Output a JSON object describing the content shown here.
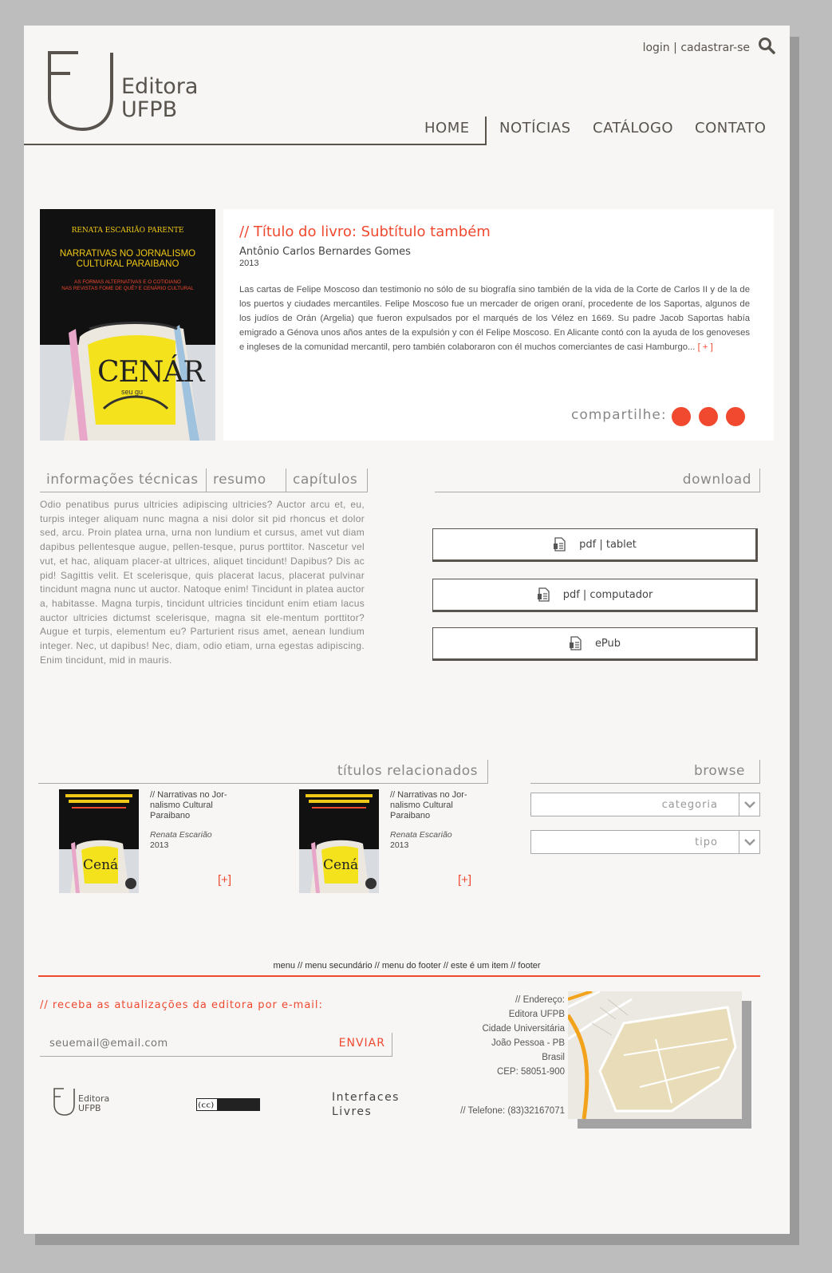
{
  "brand": {
    "logo_line1": "Editora",
    "logo_line2": "UFPB"
  },
  "top_links": {
    "login": "login",
    "separator": " | ",
    "register": "cadastrar-se"
  },
  "nav": {
    "home": "HOME",
    "news": "NOTÍCIAS",
    "catalog": "CATÁLOGO",
    "contact": "CONTATO"
  },
  "feature": {
    "cover_author": "RENATA ESCARIÃO PARENTE",
    "cover_title1": "NARRATIVAS NO JORNALISMO",
    "cover_title2": "CULTURAL PARAIBANO",
    "cover_subtitle1": "AS FORMAS ALTERNATIVAS E O COTIDIANO",
    "cover_subtitle2": "NAS REVISTAS FOME DE QUÊ? E CENÁRIO CULTURAL",
    "cover_word": "CENÁR",
    "cover_small": "seu gu",
    "title": "// Título do livro: Subtítulo também",
    "author": "Antônio Carlos Bernardes Gomes",
    "year": "2013",
    "description": "Las cartas de Felipe Moscoso dan testimonio no sólo de su biografía sino también de la vida de la Corte de Carlos II y de la de los puertos y ciudades mercantiles. Felipe Moscoso fue un mercader de origen oraní, procedente de los Saportas, algunos de los judíos de Orán (Argelia) que fueron expulsados por el marqués de los Vélez en 1669. Su padre Jacob Saportas había emigrado a Génova unos años antes de la expulsión y con él Felipe Moscoso. En Alicante contó con la ayuda de los genoveses e ingleses de la comunidad mercantil, pero también colaboraron con él muchos comerciantes de casi Hamburgo...",
    "more": "[ + ]",
    "share_label": "compartilhe:"
  },
  "tabs": [
    "informações técnicas",
    "resumo",
    "capítulos"
  ],
  "tab_content": "Odio penatibus purus ultricies adipiscing ultricies? Auctor arcu et, eu, turpis integer aliquam nunc magna a nisi dolor sit pid rhoncus et dolor sed, arcu. Proin platea urna, urna non lundium et cursus, amet vut diam dapibus pellentesque augue, pellen-tesque, purus porttitor. Nascetur vel vut, et hac, aliquam placer-at ultrices, aliquet tincidunt! Dapibus? Dis ac pid! Sagittis velit. Et scelerisque, quis placerat lacus, placerat pulvinar tincidunt magna nunc ut auctor. Natoque enim! Tincidunt in platea auctor a, habitasse. Magna turpis, tincidunt ultricies tincidunt enim etiam lacus auctor ultricies dictumst scelerisque, magna sit ele-mentum porttitor? Augue et turpis, elementum eu? Parturient risus amet, aenean lundium integer. Nec, ut dapibus! Nec, diam, odio etiam, urna egestas adipiscing. Enim tincidunt, mid in mauris.",
  "download": {
    "heading": "download",
    "buttons": [
      "pdf | tablet",
      "pdf | computador",
      "ePub"
    ]
  },
  "related": {
    "heading": "títulos relacionados",
    "items": [
      {
        "title": "// Narrativas no Jor-nalismo Cultural Paraibano",
        "author": "Renata Escarião",
        "year": "2013",
        "more": "[+]"
      },
      {
        "title": "// Narrativas no Jor-nalismo Cultural Paraibano",
        "author": "Renata Escarião",
        "year": "2013",
        "more": "[+]"
      }
    ]
  },
  "browse": {
    "heading": "browse",
    "category": "categoria",
    "type": "tipo"
  },
  "footer": {
    "menu": "menu // menu secundário // menu do footer // este é um item // footer",
    "newsletter": "// receba as atualizações da editora por e-mail:",
    "email_placeholder": "seuemail@email.com",
    "send": "ENVIAR",
    "address": [
      "// Endereço:",
      "Editora UFPB",
      "Cidade Universitária",
      "João Pessoa - PB",
      "Brasil",
      "CEP: 58051-900"
    ],
    "phone": "// Telefone: (83)32167071",
    "cc": "(cc) BY-NC-ND",
    "interfaces_line1": "Interfaces",
    "interfaces_line2": "Livres",
    "logo_line1": "Editora",
    "logo_line2": "UFPB"
  },
  "colors": {
    "accent": "#f0492f",
    "brand": "#58534d",
    "page": "#f7f6f4"
  }
}
